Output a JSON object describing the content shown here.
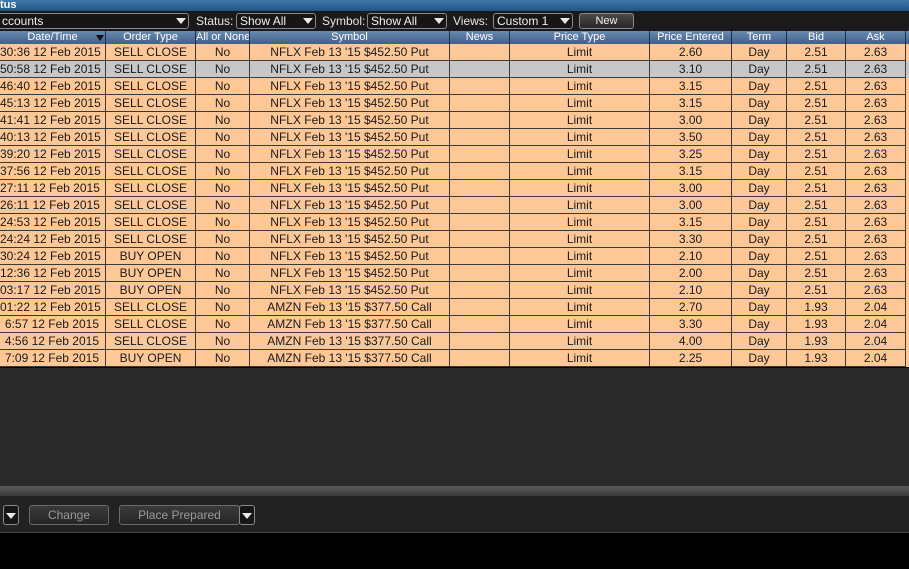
{
  "window": {
    "title": "tus"
  },
  "filters": {
    "accounts_value": "ccounts",
    "status_label": "Status:",
    "status_value": "Show All",
    "symbol_label": "Symbol:",
    "symbol_value": "Show All",
    "views_label": "Views:",
    "views_value": "Custom 1",
    "new_button": "New"
  },
  "table": {
    "columns": [
      "Date/Time",
      "Order Type",
      "All or None",
      "Symbol",
      "News",
      "Price Type",
      "Price Entered",
      "Term",
      "Bid",
      "Ask"
    ],
    "rows": [
      [
        "30:36 12 Feb 2015",
        "SELL CLOSE",
        "No",
        "NFLX Feb 13 '15 $452.50 Put",
        "",
        "Limit",
        "2.60",
        "Day",
        "2.51",
        "2.63"
      ],
      [
        "50:58 12 Feb 2015",
        "SELL CLOSE",
        "No",
        "NFLX Feb 13 '15 $452.50 Put",
        "",
        "Limit",
        "3.10",
        "Day",
        "2.51",
        "2.63"
      ],
      [
        "46:40 12 Feb 2015",
        "SELL CLOSE",
        "No",
        "NFLX Feb 13 '15 $452.50 Put",
        "",
        "Limit",
        "3.15",
        "Day",
        "2.51",
        "2.63"
      ],
      [
        "45:13 12 Feb 2015",
        "SELL CLOSE",
        "No",
        "NFLX Feb 13 '15 $452.50 Put",
        "",
        "Limit",
        "3.15",
        "Day",
        "2.51",
        "2.63"
      ],
      [
        "41:41 12 Feb 2015",
        "SELL CLOSE",
        "No",
        "NFLX Feb 13 '15 $452.50 Put",
        "",
        "Limit",
        "3.00",
        "Day",
        "2.51",
        "2.63"
      ],
      [
        "40:13 12 Feb 2015",
        "SELL CLOSE",
        "No",
        "NFLX Feb 13 '15 $452.50 Put",
        "",
        "Limit",
        "3.50",
        "Day",
        "2.51",
        "2.63"
      ],
      [
        "39:20 12 Feb 2015",
        "SELL CLOSE",
        "No",
        "NFLX Feb 13 '15 $452.50 Put",
        "",
        "Limit",
        "3.25",
        "Day",
        "2.51",
        "2.63"
      ],
      [
        "37:56 12 Feb 2015",
        "SELL CLOSE",
        "No",
        "NFLX Feb 13 '15 $452.50 Put",
        "",
        "Limit",
        "3.15",
        "Day",
        "2.51",
        "2.63"
      ],
      [
        "27:11 12 Feb 2015",
        "SELL CLOSE",
        "No",
        "NFLX Feb 13 '15 $452.50 Put",
        "",
        "Limit",
        "3.00",
        "Day",
        "2.51",
        "2.63"
      ],
      [
        "26:11 12 Feb 2015",
        "SELL CLOSE",
        "No",
        "NFLX Feb 13 '15 $452.50 Put",
        "",
        "Limit",
        "3.00",
        "Day",
        "2.51",
        "2.63"
      ],
      [
        "24:53 12 Feb 2015",
        "SELL CLOSE",
        "No",
        "NFLX Feb 13 '15 $452.50 Put",
        "",
        "Limit",
        "3.15",
        "Day",
        "2.51",
        "2.63"
      ],
      [
        "24:24 12 Feb 2015",
        "SELL CLOSE",
        "No",
        "NFLX Feb 13 '15 $452.50 Put",
        "",
        "Limit",
        "3.30",
        "Day",
        "2.51",
        "2.63"
      ],
      [
        "30:24 12 Feb 2015",
        "BUY OPEN",
        "No",
        "NFLX Feb 13 '15 $452.50 Put",
        "",
        "Limit",
        "2.10",
        "Day",
        "2.51",
        "2.63"
      ],
      [
        "12:36 12 Feb 2015",
        "BUY OPEN",
        "No",
        "NFLX Feb 13 '15 $452.50 Put",
        "",
        "Limit",
        "2.00",
        "Day",
        "2.51",
        "2.63"
      ],
      [
        "03:17 12 Feb 2015",
        "BUY OPEN",
        "No",
        "NFLX Feb 13 '15 $452.50 Put",
        "",
        "Limit",
        "2.10",
        "Day",
        "2.51",
        "2.63"
      ],
      [
        "01:22 12 Feb 2015",
        "SELL CLOSE",
        "No",
        "AMZN Feb 13 '15 $377.50 Call",
        "",
        "Limit",
        "2.70",
        "Day",
        "1.93",
        "2.04"
      ],
      [
        "6:57 12 Feb 2015",
        "SELL CLOSE",
        "No",
        "AMZN Feb 13 '15 $377.50 Call",
        "",
        "Limit",
        "3.30",
        "Day",
        "1.93",
        "2.04"
      ],
      [
        "4:56 12 Feb 2015",
        "SELL CLOSE",
        "No",
        "AMZN Feb 13 '15 $377.50 Call",
        "",
        "Limit",
        "4.00",
        "Day",
        "1.93",
        "2.04"
      ],
      [
        "7:09 12 Feb 2015",
        "BUY OPEN",
        "No",
        "AMZN Feb 13 '15 $377.50 Call",
        "",
        "Limit",
        "2.25",
        "Day",
        "1.93",
        "2.04"
      ]
    ],
    "selected_row": 1
  },
  "bottom": {
    "change_button": "Change",
    "place_prepared_button": "Place Prepared"
  },
  "colors": {
    "row_bg": "#fec896",
    "selected_row_bg": "#c7c7c7",
    "header_bg": "#4f6f98",
    "titlebar_bg": "#2a6195"
  }
}
